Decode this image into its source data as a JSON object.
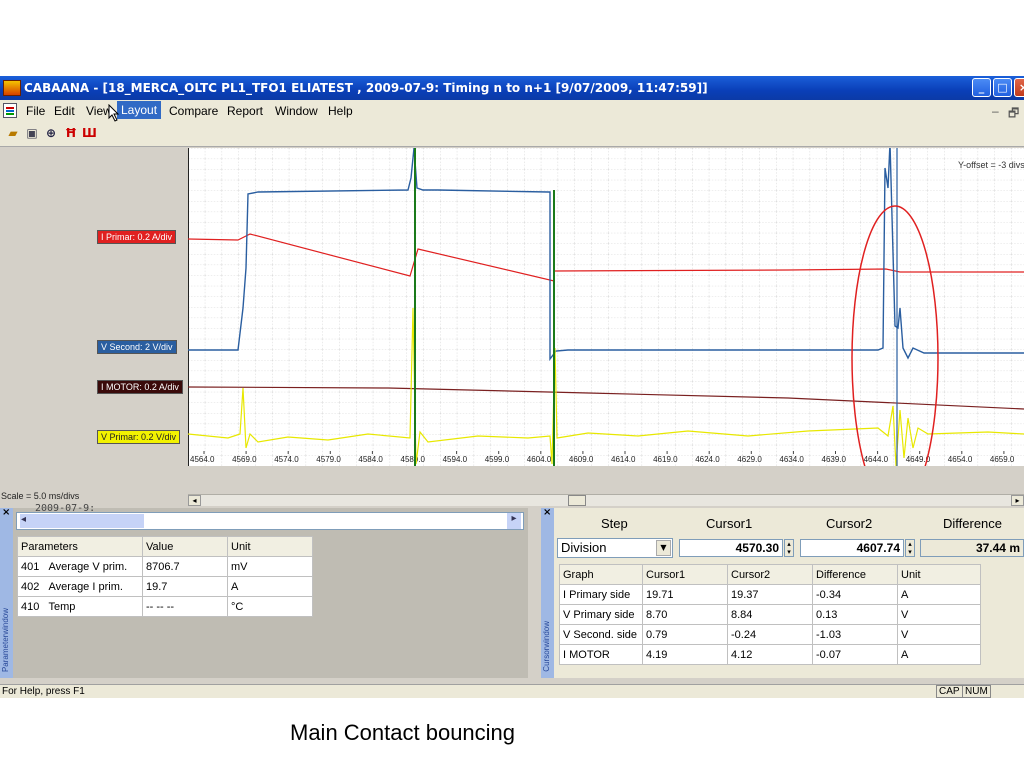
{
  "window": {
    "title": "CABAANA - [18_MERCA_OLTC PL1_TFO1  ELIATEST  , 2009-07-9: Timing n to n+1  [9/07/2009, 11:47:59]]"
  },
  "menu": {
    "file": "File",
    "edit": "Edit",
    "view": "View",
    "layout": "Layout",
    "compare": "Compare",
    "report": "Report",
    "window": "Window",
    "help": "Help",
    "min_glyph": "–",
    "restore_glyph": "🗗"
  },
  "scope": {
    "offset_label": "Y-offset = -3 divs",
    "scale_label": "Scale = 5.0 ms/divs",
    "channels": {
      "i_primar": "I Primar: 0.2 A/div",
      "v_second": "V Second: 2 V/div",
      "i_motor": "I MOTOR: 0.2 A/div",
      "v_primar": "V Primar: 0.2 V/div"
    },
    "x_ticks": [
      "4564.0",
      "4569.0",
      "4574.0",
      "4579.0",
      "4584.0",
      "4589.0",
      "4594.0",
      "4599.0",
      "4604.0",
      "4609.0",
      "4614.0",
      "4619.0",
      "4624.0",
      "4629.0",
      "4634.0",
      "4639.0",
      "4644.0",
      "4649.0",
      "4654.0",
      "4659.0"
    ],
    "colors": {
      "i_primar": "#e02020",
      "v_second": "#2a5ea0",
      "i_motor": "#702020",
      "v_primar": "#e8e800",
      "annotation": "#e02020",
      "cursor": "#1a7a1a"
    }
  },
  "params_panel": {
    "sidebar_label": "Parameterwindow",
    "date_fragment": "2009-07-9:",
    "headers": [
      "Parameters",
      "Value",
      "Unit"
    ],
    "rows": [
      {
        "id": "401",
        "name": "Average V prim.",
        "value": "8706.7",
        "unit": "mV"
      },
      {
        "id": "402",
        "name": "Average I prim.",
        "value": "19.7",
        "unit": "A"
      },
      {
        "id": "410",
        "name": "Temp",
        "value": "-- -- --",
        "unit": "°C"
      }
    ]
  },
  "cursor_panel": {
    "sidebar_label": "Cursorwindow",
    "step_label": "Step",
    "cursor1_label": "Cursor1",
    "cursor2_label": "Cursor2",
    "difference_label": "Difference",
    "step_mode": "Division",
    "cursor1_value": "4570.30",
    "cursor2_value": "4607.74",
    "difference_value": "37.44 m",
    "headers": [
      "Graph",
      "Cursor1",
      "Cursor2",
      "Difference",
      "Unit"
    ],
    "rows": [
      {
        "graph": "I Primary side",
        "c1": "19.71",
        "c2": "19.37",
        "diff": "-0.34",
        "unit": "A"
      },
      {
        "graph": "V Primary side",
        "c1": "8.70",
        "c2": "8.84",
        "diff": "0.13",
        "unit": "V"
      },
      {
        "graph": "V Second. side",
        "c1": "0.79",
        "c2": "-0.24",
        "diff": "-1.03",
        "unit": "V"
      },
      {
        "graph": "I MOTOR",
        "c1": "4.19",
        "c2": "4.12",
        "diff": "-0.07",
        "unit": "A"
      }
    ]
  },
  "status": {
    "help": "For Help, press F1",
    "cap": "CAP",
    "num": "NUM"
  },
  "caption": "Main Contact bouncing"
}
